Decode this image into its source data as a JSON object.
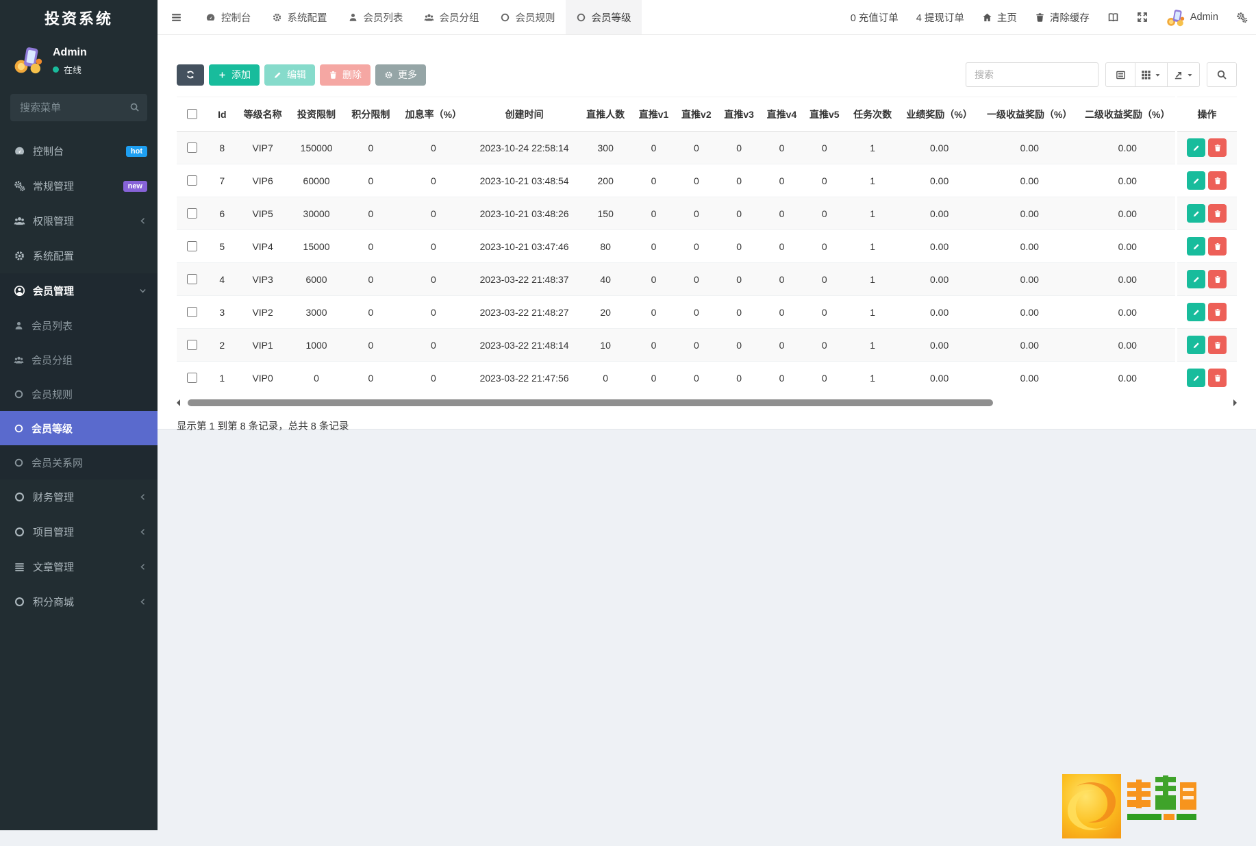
{
  "app": {
    "title": "投资系统"
  },
  "colors": {
    "accent": "#5a6acd",
    "success": "#18bc9c",
    "danger": "#ed6058",
    "sidebar": "#222d32",
    "badge_hot": "#1e9ff2",
    "badge_new": "#8763d8"
  },
  "sidebar": {
    "user": {
      "name": "Admin",
      "status": "在线"
    },
    "search_placeholder": "搜索菜单",
    "menu": [
      {
        "key": "console",
        "label": "控制台",
        "icon": "gauge",
        "badge": "hot",
        "badge_color": "#1e9ff2"
      },
      {
        "key": "general",
        "label": "常规管理",
        "icon": "cogs",
        "badge": "new",
        "badge_color": "#8763d8"
      },
      {
        "key": "auth",
        "label": "权限管理",
        "icon": "users",
        "chevron": "left"
      },
      {
        "key": "sysconfig",
        "label": "系统配置",
        "icon": "gear"
      },
      {
        "key": "member",
        "label": "会员管理",
        "icon": "user-circle",
        "chevron": "down",
        "open": true,
        "children": [
          {
            "key": "member-list",
            "label": "会员列表",
            "icon": "user"
          },
          {
            "key": "member-group",
            "label": "会员分组",
            "icon": "users"
          },
          {
            "key": "member-rule",
            "label": "会员规则",
            "icon": "circle"
          },
          {
            "key": "member-level",
            "label": "会员等级",
            "icon": "circle",
            "active": true
          },
          {
            "key": "member-network",
            "label": "会员关系网",
            "icon": "circle"
          }
        ]
      },
      {
        "key": "finance",
        "label": "财务管理",
        "icon": "circle",
        "chevron": "left"
      },
      {
        "key": "project",
        "label": "项目管理",
        "icon": "circle",
        "chevron": "left"
      },
      {
        "key": "article",
        "label": "文章管理",
        "icon": "list",
        "chevron": "left"
      },
      {
        "key": "points-mall",
        "label": "积分商城",
        "icon": "circle",
        "chevron": "left"
      }
    ]
  },
  "topbar": {
    "tabs": [
      {
        "key": "console",
        "label": "控制台",
        "icon": "gauge"
      },
      {
        "key": "sysconfig",
        "label": "系统配置",
        "icon": "gear"
      },
      {
        "key": "member-list",
        "label": "会员列表",
        "icon": "user"
      },
      {
        "key": "member-group",
        "label": "会员分组",
        "icon": "users"
      },
      {
        "key": "member-rule",
        "label": "会员规则",
        "icon": "circle"
      },
      {
        "key": "member-level",
        "label": "会员等级",
        "icon": "circle",
        "active": true
      }
    ],
    "right": {
      "recharge": "0 充值订单",
      "withdraw": "4 提现订单",
      "home": "主页",
      "clear_cache": "清除缓存",
      "admin": "Admin"
    }
  },
  "toolbar": {
    "add": "添加",
    "edit": "编辑",
    "delete": "删除",
    "more": "更多",
    "search_placeholder": "搜索"
  },
  "table": {
    "headers": [
      "Id",
      "等级名称",
      "投资限制",
      "积分限制",
      "加息率（%）",
      "创建时间",
      "直推人数",
      "直推v1",
      "直推v2",
      "直推v3",
      "直推v4",
      "直推v5",
      "任务次数",
      "业绩奖励（%）",
      "一级收益奖励（%）",
      "二级收益奖励（%）",
      "操作"
    ],
    "rows": [
      {
        "id": "8",
        "name": "VIP7",
        "invest": "150000",
        "score": "0",
        "rate": "0",
        "created": "2023-10-24 22:58:14",
        "direct": "300",
        "v1": "0",
        "v2": "0",
        "v3": "0",
        "v4": "0",
        "v5": "0",
        "tasks": "1",
        "perf": "0.00",
        "lv1": "0.00",
        "lv2": "0.00"
      },
      {
        "id": "7",
        "name": "VIP6",
        "invest": "60000",
        "score": "0",
        "rate": "0",
        "created": "2023-10-21 03:48:54",
        "direct": "200",
        "v1": "0",
        "v2": "0",
        "v3": "0",
        "v4": "0",
        "v5": "0",
        "tasks": "1",
        "perf": "0.00",
        "lv1": "0.00",
        "lv2": "0.00"
      },
      {
        "id": "6",
        "name": "VIP5",
        "invest": "30000",
        "score": "0",
        "rate": "0",
        "created": "2023-10-21 03:48:26",
        "direct": "150",
        "v1": "0",
        "v2": "0",
        "v3": "0",
        "v4": "0",
        "v5": "0",
        "tasks": "1",
        "perf": "0.00",
        "lv1": "0.00",
        "lv2": "0.00"
      },
      {
        "id": "5",
        "name": "VIP4",
        "invest": "15000",
        "score": "0",
        "rate": "0",
        "created": "2023-10-21 03:47:46",
        "direct": "80",
        "v1": "0",
        "v2": "0",
        "v3": "0",
        "v4": "0",
        "v5": "0",
        "tasks": "1",
        "perf": "0.00",
        "lv1": "0.00",
        "lv2": "0.00"
      },
      {
        "id": "4",
        "name": "VIP3",
        "invest": "6000",
        "score": "0",
        "rate": "0",
        "created": "2023-03-22 21:48:37",
        "direct": "40",
        "v1": "0",
        "v2": "0",
        "v3": "0",
        "v4": "0",
        "v5": "0",
        "tasks": "1",
        "perf": "0.00",
        "lv1": "0.00",
        "lv2": "0.00"
      },
      {
        "id": "3",
        "name": "VIP2",
        "invest": "3000",
        "score": "0",
        "rate": "0",
        "created": "2023-03-22 21:48:27",
        "direct": "20",
        "v1": "0",
        "v2": "0",
        "v3": "0",
        "v4": "0",
        "v5": "0",
        "tasks": "1",
        "perf": "0.00",
        "lv1": "0.00",
        "lv2": "0.00"
      },
      {
        "id": "2",
        "name": "VIP1",
        "invest": "1000",
        "score": "0",
        "rate": "0",
        "created": "2023-03-22 21:48:14",
        "direct": "10",
        "v1": "0",
        "v2": "0",
        "v3": "0",
        "v4": "0",
        "v5": "0",
        "tasks": "1",
        "perf": "0.00",
        "lv1": "0.00",
        "lv2": "0.00"
      },
      {
        "id": "1",
        "name": "VIP0",
        "invest": "0",
        "score": "0",
        "rate": "0",
        "created": "2023-03-22 21:47:56",
        "direct": "0",
        "v1": "0",
        "v2": "0",
        "v3": "0",
        "v4": "0",
        "v5": "0",
        "tasks": "1",
        "perf": "0.00",
        "lv1": "0.00",
        "lv2": "0.00"
      }
    ]
  },
  "footer": {
    "summary": "显示第 1 到第 8 条记录，总共 8 条记录"
  }
}
